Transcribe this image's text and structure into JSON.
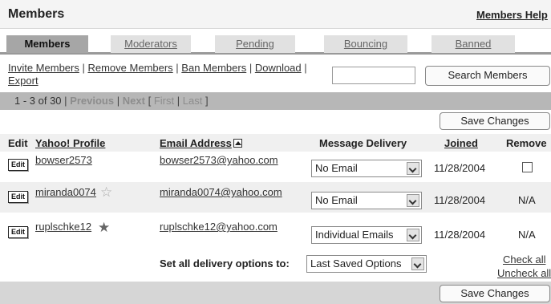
{
  "header": {
    "title": "Members",
    "help_link": "Members Help"
  },
  "tabs": [
    {
      "label": "Members",
      "active": true
    },
    {
      "label": "Moderators",
      "active": false
    },
    {
      "label": "Pending",
      "active": false
    },
    {
      "label": "Bouncing",
      "active": false
    },
    {
      "label": "Banned",
      "active": false
    }
  ],
  "actions": {
    "invite": "Invite Members",
    "remove": "Remove Members",
    "ban": "Ban Members",
    "download": "Download",
    "export": "Export",
    "separator": " | "
  },
  "search": {
    "value": "",
    "button": "Search Members"
  },
  "pager": {
    "range": "1 - 3 of 30",
    "previous": "Previous",
    "next": "Next",
    "first": "First",
    "last": "Last",
    "open_bracket": "[",
    "close_bracket": "]",
    "sep": "|"
  },
  "save_button": "Save Changes",
  "columns": {
    "edit": "Edit",
    "profile": "Yahoo! Profile",
    "email": "Email Address",
    "delivery": "Message Delivery",
    "joined": "Joined",
    "remove": "Remove"
  },
  "edit_label": "Edit",
  "members": [
    {
      "profile": "bowser2573",
      "email": "bowser2573@yahoo.com",
      "delivery": "No Email",
      "joined": "11/28/2004",
      "remove": ""
    },
    {
      "profile": "miranda0074",
      "email": "miranda0074@yahoo.com",
      "delivery": "No Email",
      "joined": "11/28/2004",
      "remove": "N/A",
      "star": "☆"
    },
    {
      "profile": "ruplschke12",
      "email": "ruplschke12@yahoo.com",
      "delivery": "Individual Emails",
      "joined": "11/28/2004",
      "remove": "N/A",
      "star": "★"
    }
  ],
  "footer": {
    "label": "Set all delivery options to:",
    "selected": "Last Saved Options",
    "check_all": "Check all",
    "uncheck_all": "Uncheck all"
  },
  "colors": {
    "tab_active": "#a6a6a6",
    "tab_inactive": "#e1e1e1",
    "pager_bar": "#b7b7b7",
    "row_alt": "#efefef"
  }
}
